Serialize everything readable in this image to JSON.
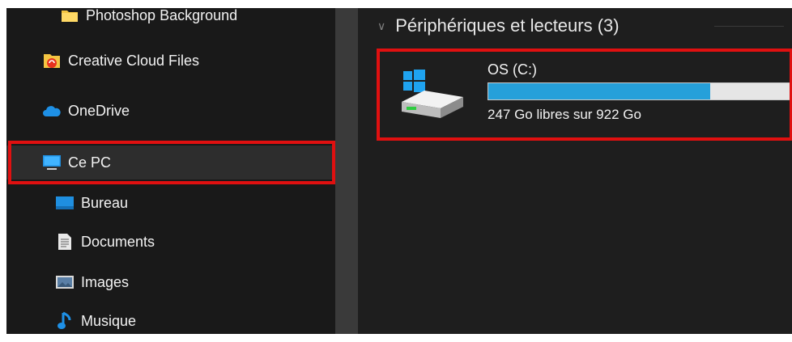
{
  "sidebar": {
    "items": [
      {
        "label": "Photoshop Background",
        "icon": "folder-icon"
      },
      {
        "label": "Creative Cloud Files",
        "icon": "creative-cloud-files-icon"
      },
      {
        "label": "OneDrive",
        "icon": "onedrive-cloud-icon"
      },
      {
        "label": "Ce PC",
        "icon": "computer-icon",
        "selected": true
      },
      {
        "label": "Bureau",
        "icon": "desktop-folder-icon"
      },
      {
        "label": "Documents",
        "icon": "documents-icon"
      },
      {
        "label": "Images",
        "icon": "pictures-icon"
      },
      {
        "label": "Musique",
        "icon": "music-icon"
      }
    ]
  },
  "main": {
    "section_title": "Périphériques et lecteurs (3)",
    "drive": {
      "name": "OS (C:)",
      "free_text": "247 Go libres sur 922 Go",
      "used_fraction": 0.73,
      "icon": "windows-drive-icon"
    }
  },
  "colors": {
    "highlight": "#e01010",
    "progress": "#26a0da",
    "background": "#191919"
  }
}
